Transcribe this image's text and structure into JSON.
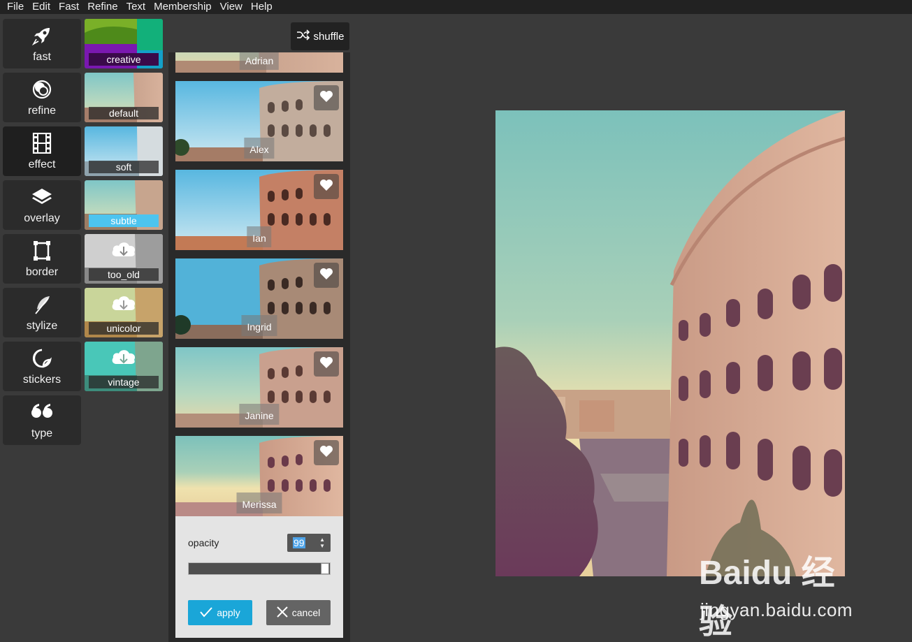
{
  "menu": [
    "File",
    "Edit",
    "Fast",
    "Refine",
    "Text",
    "Membership",
    "View",
    "Help"
  ],
  "tools": [
    {
      "label": "fast",
      "icon": "rocket-icon"
    },
    {
      "label": "refine",
      "icon": "refine-circles-icon"
    },
    {
      "label": "effect",
      "icon": "film-strip-icon"
    },
    {
      "label": "overlay",
      "icon": "layers-icon"
    },
    {
      "label": "border",
      "icon": "frame-icon"
    },
    {
      "label": "stylize",
      "icon": "feather-icon"
    },
    {
      "label": "stickers",
      "icon": "sticker-icon"
    },
    {
      "label": "type",
      "icon": "quote-icon"
    }
  ],
  "categories": [
    {
      "label": "creative"
    },
    {
      "label": "default"
    },
    {
      "label": "soft"
    },
    {
      "label": "subtle"
    },
    {
      "label": "too_old"
    },
    {
      "label": "unicolor"
    },
    {
      "label": "vintage"
    }
  ],
  "shuffle_label": "shuffle",
  "effects": [
    {
      "name": "Adrian"
    },
    {
      "name": "Alex"
    },
    {
      "name": "Ian"
    },
    {
      "name": "Ingrid"
    },
    {
      "name": "Janine"
    },
    {
      "name": "Merissa"
    }
  ],
  "opacity": {
    "label": "opacity",
    "value": "99"
  },
  "apply_label": "apply",
  "cancel_label": "cancel",
  "watermark": {
    "text": "Baidu 经验",
    "sub": "jingyan.baidu.com"
  }
}
